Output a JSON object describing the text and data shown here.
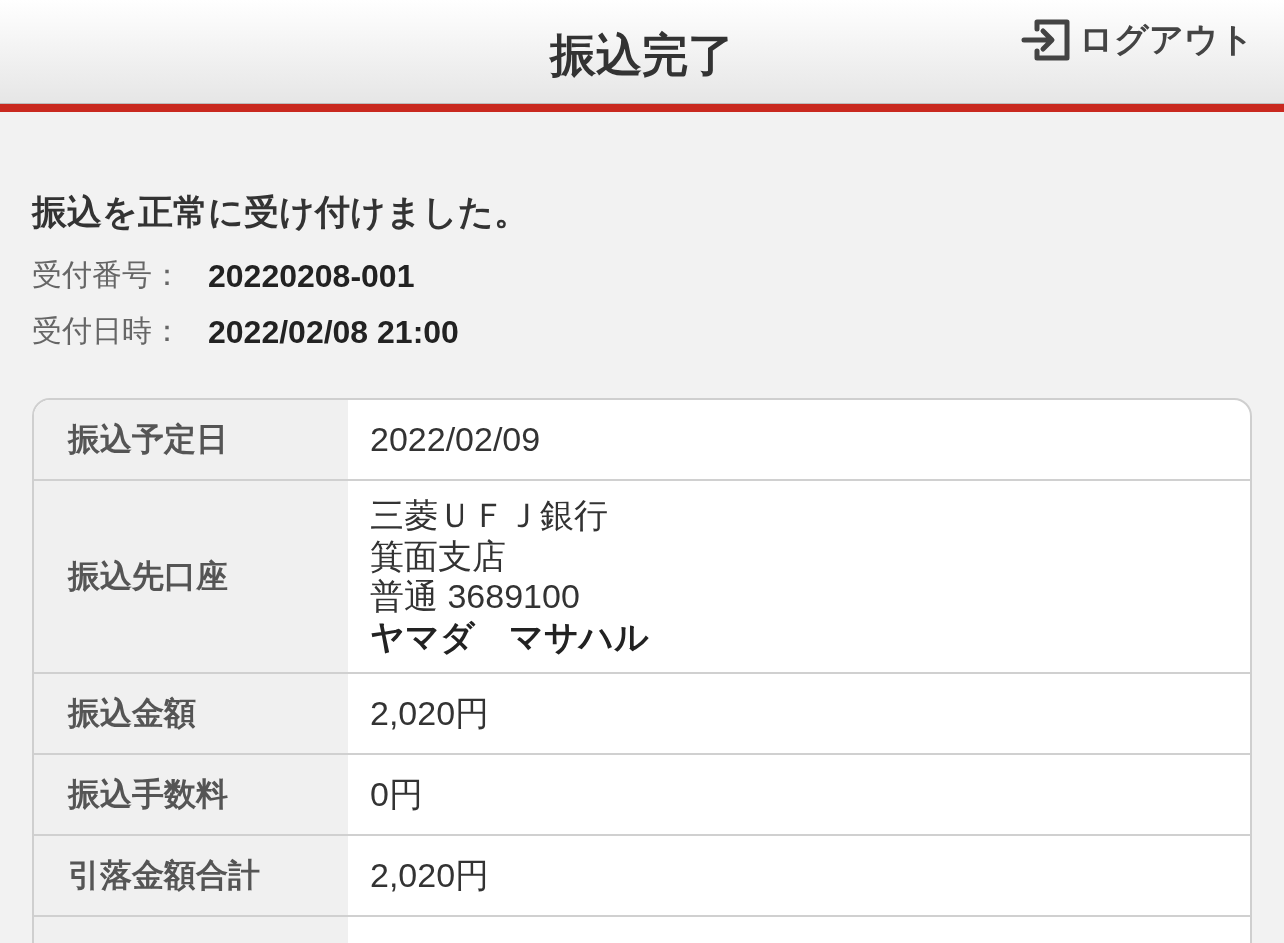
{
  "header": {
    "title": "振込完了",
    "logout": "ログアウト"
  },
  "message": "振込を正常に受け付けました。",
  "receipt": [
    {
      "label": "受付番号：",
      "value": "20220208-001"
    },
    {
      "label": "受付日時：",
      "value": "2022/02/08 21:00"
    }
  ],
  "table": {
    "rows": [
      {
        "label": "振込予定日",
        "lines": [
          {
            "text": "2022/02/09",
            "bold": false
          }
        ]
      },
      {
        "label": "振込先口座",
        "lines": [
          {
            "text": "三菱ＵＦＪ銀行",
            "bold": false
          },
          {
            "text": "箕面支店",
            "bold": false
          },
          {
            "text": "普通 3689100",
            "bold": false
          },
          {
            "text": "ヤマダ　マサハル",
            "bold": true
          }
        ]
      },
      {
        "label": "振込金額",
        "lines": [
          {
            "text": "2,020円",
            "bold": false
          }
        ]
      },
      {
        "label": "振込手数料",
        "lines": [
          {
            "text": "0円",
            "bold": false
          }
        ]
      },
      {
        "label": "引落金額合計",
        "lines": [
          {
            "text": "2,020円",
            "bold": false
          }
        ]
      }
    ]
  }
}
